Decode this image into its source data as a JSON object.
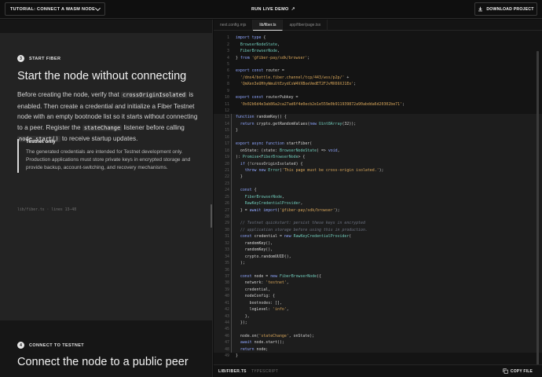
{
  "header": {
    "tutorial_select": "TUTORIAL: CONNECT A WASM NODE",
    "run_demo": "RUN LIVE DEMO",
    "run_demo_icon": "↗",
    "download": "DOWNLOAD PROJECT"
  },
  "step3": {
    "num": "3",
    "kicker": "START FIBER",
    "title": "Start the node without connecting",
    "p1": "Before creating the node, verify that ",
    "c1": "crossOriginIsolated",
    "p2": " is enabled. Then create a credential and initialize a Fiber Testnet node with an empty bootnode list so it starts without connecting to a peer. Register the ",
    "c2": "stateChange",
    "p3": " listener before calling ",
    "c3": "node.start()",
    "p4": " to receive startup updates.",
    "callout_title": "Testnet only",
    "callout_body": "The generated credentials are intended for Testnet development only. Production applications must store private keys in encrypted storage and provide backup, account-switching, and recovery mechanisms.",
    "source_ref": "lib/fiber.ts · lines 13–48"
  },
  "step4": {
    "num": "4",
    "kicker": "CONNECT TO TESTNET",
    "title": "Connect the node to a public peer"
  },
  "editor": {
    "tabs": [
      {
        "label": "next.config.mjs",
        "active": false
      },
      {
        "label": "lib/fiber.ts",
        "active": true
      },
      {
        "label": "app/fiber/page.tsx",
        "active": false
      }
    ],
    "file_label": "LIB/FIBER.TS",
    "lang_label": "TYPESCRIPT",
    "copy_label": "COPY FILE",
    "highlight_range": [
      13,
      48
    ],
    "lines": [
      [
        [
          "kw",
          "import type "
        ],
        [
          "pl",
          "{"
        ]
      ],
      [
        [
          "pl",
          "  "
        ],
        [
          "ty",
          "BrowserNodeState"
        ],
        [
          "pl",
          ","
        ]
      ],
      [
        [
          "pl",
          "  "
        ],
        [
          "ty",
          "FiberBrowserNode"
        ],
        [
          "pl",
          ","
        ]
      ],
      [
        [
          "pl",
          "} "
        ],
        [
          "kw",
          "from "
        ],
        [
          "str",
          "'@fiber-pay/sdk/browser'"
        ],
        [
          "pl",
          ";"
        ]
      ],
      [],
      [
        [
          "kw",
          "export const "
        ],
        [
          "pl",
          "router ="
        ]
      ],
      [
        [
          "pl",
          "  "
        ],
        [
          "str",
          "'/dns4/bottle.fiber.channel/tcp/443/wss/p2p/'"
        ],
        [
          "pl",
          " +"
        ]
      ],
      [
        [
          "pl",
          "  "
        ],
        [
          "str",
          "'QmXen3eUHhyWmuUtEzydCsW4VXBoeVmdET2FJvMX69XJ1Eo'"
        ],
        [
          "pl",
          ";"
        ]
      ],
      [],
      [
        [
          "kw",
          "export const "
        ],
        [
          "pl",
          "routerPubkey ="
        ]
      ],
      [
        [
          "pl",
          "  "
        ],
        [
          "str",
          "'0x02b6d4e3ab86a2ca27ad6f4e0ecb2e1e559e0b911939872a90abdda6d20302be71'"
        ],
        [
          "pl",
          ";"
        ]
      ],
      [],
      [
        [
          "kw",
          "function "
        ],
        [
          "fn",
          "randomKey"
        ],
        [
          "pl",
          "() {"
        ]
      ],
      [
        [
          "pl",
          "  "
        ],
        [
          "kw",
          "return "
        ],
        [
          "pl",
          "crypto."
        ],
        [
          "fn",
          "getRandomValues"
        ],
        [
          "pl",
          "("
        ],
        [
          "kw",
          "new "
        ],
        [
          "ty",
          "Uint8Array"
        ],
        [
          "pl",
          "(32));"
        ]
      ],
      [
        [
          "pl",
          "}"
        ]
      ],
      [],
      [
        [
          "kw",
          "export async function "
        ],
        [
          "fn",
          "startFiber"
        ],
        [
          "pl",
          "("
        ]
      ],
      [
        [
          "pl",
          "  onState: (state: "
        ],
        [
          "ty",
          "BrowserNodeState"
        ],
        [
          "pl",
          ") => "
        ],
        [
          "kw",
          "void"
        ],
        [
          "pl",
          ","
        ]
      ],
      [
        [
          "pl",
          "): "
        ],
        [
          "ty",
          "Promise"
        ],
        [
          "pl",
          "<"
        ],
        [
          "ty",
          "FiberBrowserNode"
        ],
        [
          "pl",
          "> {"
        ]
      ],
      [
        [
          "pl",
          "  "
        ],
        [
          "kw",
          "if "
        ],
        [
          "pl",
          "(!crossOriginIsolated) {"
        ]
      ],
      [
        [
          "pl",
          "    "
        ],
        [
          "kw",
          "throw new "
        ],
        [
          "ty",
          "Error"
        ],
        [
          "pl",
          "("
        ],
        [
          "str",
          "'This page must be cross-origin isolated.'"
        ],
        [
          "pl",
          ");"
        ]
      ],
      [
        [
          "pl",
          "  }"
        ]
      ],
      [],
      [
        [
          "pl",
          "  "
        ],
        [
          "kw",
          "const "
        ],
        [
          "pl",
          "{"
        ]
      ],
      [
        [
          "pl",
          "    "
        ],
        [
          "ty",
          "FiberBrowserNode"
        ],
        [
          "pl",
          ","
        ]
      ],
      [
        [
          "pl",
          "    "
        ],
        [
          "ty",
          "RawKeyCredentialProvider"
        ],
        [
          "pl",
          ","
        ]
      ],
      [
        [
          "pl",
          "  } = "
        ],
        [
          "kw",
          "await import"
        ],
        [
          "pl",
          "("
        ],
        [
          "str",
          "'@fiber-pay/sdk/browser'"
        ],
        [
          "pl",
          ");"
        ]
      ],
      [],
      [
        [
          "cmt",
          "  // Testnet quickstart: persist these keys in encrypted"
        ]
      ],
      [
        [
          "cmt",
          "  // application storage before using this in production."
        ]
      ],
      [
        [
          "pl",
          "  "
        ],
        [
          "kw",
          "const "
        ],
        [
          "pl",
          "credential = "
        ],
        [
          "kw",
          "new "
        ],
        [
          "ty",
          "RawKeyCredentialProvider"
        ],
        [
          "pl",
          "("
        ]
      ],
      [
        [
          "pl",
          "    "
        ],
        [
          "fn",
          "randomKey"
        ],
        [
          "pl",
          "(),"
        ]
      ],
      [
        [
          "pl",
          "    "
        ],
        [
          "fn",
          "randomKey"
        ],
        [
          "pl",
          "(),"
        ]
      ],
      [
        [
          "pl",
          "    crypto."
        ],
        [
          "fn",
          "randomUUID"
        ],
        [
          "pl",
          "(),"
        ]
      ],
      [
        [
          "pl",
          "  );"
        ]
      ],
      [],
      [
        [
          "pl",
          "  "
        ],
        [
          "kw",
          "const "
        ],
        [
          "pl",
          "node = "
        ],
        [
          "kw",
          "new "
        ],
        [
          "ty",
          "FiberBrowserNode"
        ],
        [
          "pl",
          "({"
        ]
      ],
      [
        [
          "pl",
          "    network: "
        ],
        [
          "str",
          "'testnet'"
        ],
        [
          "pl",
          ","
        ]
      ],
      [
        [
          "pl",
          "    credential,"
        ]
      ],
      [
        [
          "pl",
          "    nodeConfig: {"
        ]
      ],
      [
        [
          "pl",
          "      bootnodes: [],"
        ]
      ],
      [
        [
          "pl",
          "      logLevel: "
        ],
        [
          "str",
          "'info'"
        ],
        [
          "pl",
          ","
        ]
      ],
      [
        [
          "pl",
          "    },"
        ]
      ],
      [
        [
          "pl",
          "  });"
        ]
      ],
      [],
      [
        [
          "pl",
          "  node."
        ],
        [
          "fn",
          "on"
        ],
        [
          "pl",
          "("
        ],
        [
          "str",
          "'stateChange'"
        ],
        [
          "pl",
          ", onState);"
        ]
      ],
      [
        [
          "pl",
          "  "
        ],
        [
          "kw",
          "await "
        ],
        [
          "pl",
          "node."
        ],
        [
          "fn",
          "start"
        ],
        [
          "pl",
          "();"
        ]
      ],
      [
        [
          "pl",
          "  "
        ],
        [
          "kw",
          "return "
        ],
        [
          "pl",
          "node;"
        ]
      ],
      [
        [
          "pl",
          "}"
        ]
      ]
    ]
  }
}
